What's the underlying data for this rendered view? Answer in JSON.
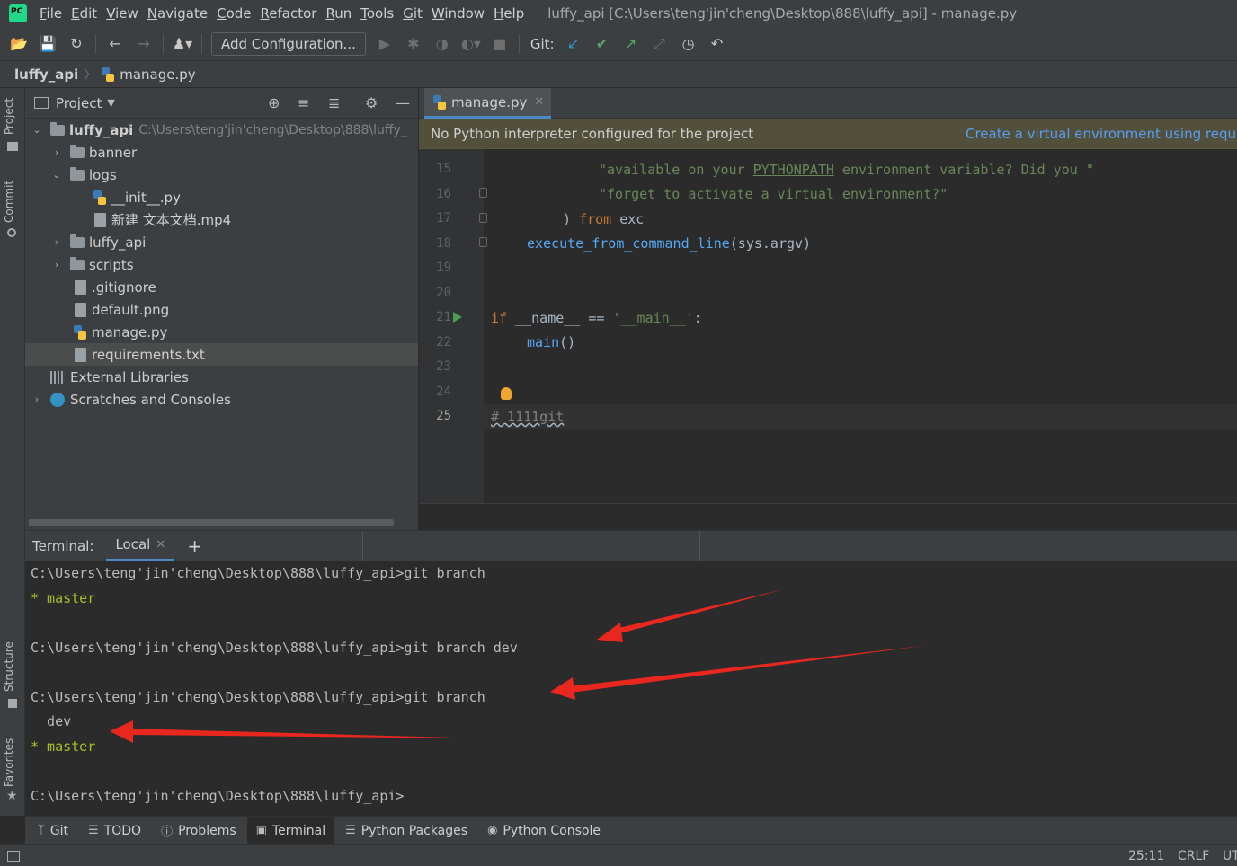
{
  "menu": {
    "items": [
      {
        "label": "File",
        "u": "F",
        "rest": "ile"
      },
      {
        "label": "Edit",
        "u": "E",
        "rest": "dit"
      },
      {
        "label": "View",
        "u": "V",
        "rest": "iew"
      },
      {
        "label": "Navigate",
        "u": "N",
        "rest": "avigate"
      },
      {
        "label": "Code",
        "u": "C",
        "rest": "ode"
      },
      {
        "label": "Refactor",
        "u": "R",
        "rest": "efactor"
      },
      {
        "label": "Run",
        "u": "R",
        "rest": "un"
      },
      {
        "label": "Tools",
        "u": "T",
        "rest": "ools"
      },
      {
        "label": "Git",
        "u": "G",
        "rest": "it"
      },
      {
        "label": "Window",
        "u": "W",
        "rest": "indow"
      },
      {
        "label": "Help",
        "u": "H",
        "rest": "elp"
      }
    ],
    "window_title": "luffy_api [C:\\Users\\teng'jin'cheng\\Desktop\\888\\luffy_api] - manage.py"
  },
  "toolbar": {
    "add_configuration": "Add Configuration...",
    "git_label": "Git:"
  },
  "breadcrumb": {
    "project": "luffy_api",
    "file": "manage.py"
  },
  "stripe": {
    "project": "Project",
    "commit": "Commit",
    "structure": "Structure",
    "favorites": "Favorites"
  },
  "project_panel": {
    "title": "Project",
    "root_name": "luffy_api",
    "root_path": "C:\\Users\\teng'jin'cheng\\Desktop\\888\\luffy_",
    "rows": {
      "banner": "banner",
      "logs": "logs",
      "init": "__init__.py",
      "mp4": "新建 文本文档.mp4",
      "luffy_api": "luffy_api",
      "scripts": "scripts",
      "gitignore": ".gitignore",
      "default_png": "default.png",
      "manage_py": "manage.py",
      "requirements": "requirements.txt",
      "external_libraries": "External Libraries",
      "scratches": "Scratches and Consoles"
    }
  },
  "editor": {
    "tab_label": "manage.py",
    "warning_text": "No Python interpreter configured for the project",
    "warning_link": "Create a virtual environment using require",
    "line_numbers": [
      "15",
      "16",
      "17",
      "18",
      "19",
      "20",
      "21",
      "22",
      "23",
      "24",
      "25"
    ],
    "code": {
      "l15_a": "\"available on your ",
      "l15_b": "PYTHONPATH",
      "l15_c": " environment variable? Did you \"",
      "l16": "\"forget to activate a virtual environment?\"",
      "l17_a": ") ",
      "l17_b": "from",
      "l17_c": " exc",
      "l18_a": "execute_from_command_line",
      "l18_b": "(sys.argv)",
      "l21_a": "if",
      "l21_b": " __name__ == ",
      "l21_c": "'__main__'",
      "l21_d": ":",
      "l22_a": "main",
      "l22_b": "()",
      "l25": "# 1111git"
    }
  },
  "terminal": {
    "label": "Terminal:",
    "tab": "Local",
    "lines": [
      "C:\\Users\\teng'jin'cheng\\Desktop\\888\\luffy_api>git branch",
      "* master",
      "",
      "C:\\Users\\teng'jin'cheng\\Desktop\\888\\luffy_api>git branch dev",
      "",
      "C:\\Users\\teng'jin'cheng\\Desktop\\888\\luffy_api>git branch",
      "  dev",
      "* master",
      "",
      "C:\\Users\\teng'jin'cheng\\Desktop\\888\\luffy_api>"
    ]
  },
  "tool_tabs": {
    "git": "Git",
    "todo": "TODO",
    "problems": "Problems",
    "terminal": "Terminal",
    "python_packages": "Python Packages",
    "python_console": "Python Console"
  },
  "status": {
    "position": "25:11",
    "line_ending": "CRLF",
    "encoding": "UT"
  },
  "colors": {
    "accent": "#4a88c7",
    "arrow": "#e8271f",
    "terminal_green": "#a8c023",
    "warning_bg": "#52503a"
  }
}
